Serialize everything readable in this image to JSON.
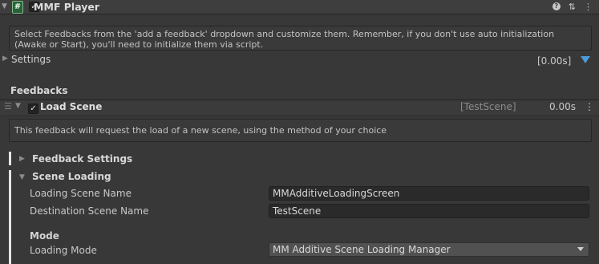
{
  "header": {
    "script_icon_glyph": "#",
    "checkbox_glyph": "✓",
    "title": "MMF Player",
    "icons": [
      "help-icon",
      "sliders-icon",
      "kebab-menu-icon"
    ]
  },
  "info": {
    "text": "Select Feedbacks from the 'add a feedback' dropdown and customize them. Remember, if you don't use auto initialization (Awake or Start), you'll need to initialize them via script."
  },
  "settings": {
    "label": "Settings",
    "time": "[0.00s]"
  },
  "feedbacks": {
    "heading": "Feedbacks",
    "items": [
      {
        "title": "Load Scene",
        "scene_tag": "[TestScene]",
        "duration": "0.00s",
        "description": "This feedback will request the load of a new scene, using the method of your choice",
        "sections": {
          "feedback_settings": "Feedback Settings",
          "scene_loading": "Scene Loading",
          "mode_heading": "Mode"
        },
        "fields": {
          "loading_scene_name_label": "Loading Scene Name",
          "loading_scene_name_value": "MMAdditiveLoadingScreen",
          "destination_scene_name_label": "Destination Scene Name",
          "destination_scene_name_value": "TestScene",
          "loading_mode_label": "Loading Mode",
          "loading_mode_value": "MM Additive Scene Loading Manager"
        }
      }
    ]
  },
  "colors": {
    "background": "#383838",
    "accent_blue": "#4c9bd9",
    "script_icon_green": "#2c5f3c"
  }
}
